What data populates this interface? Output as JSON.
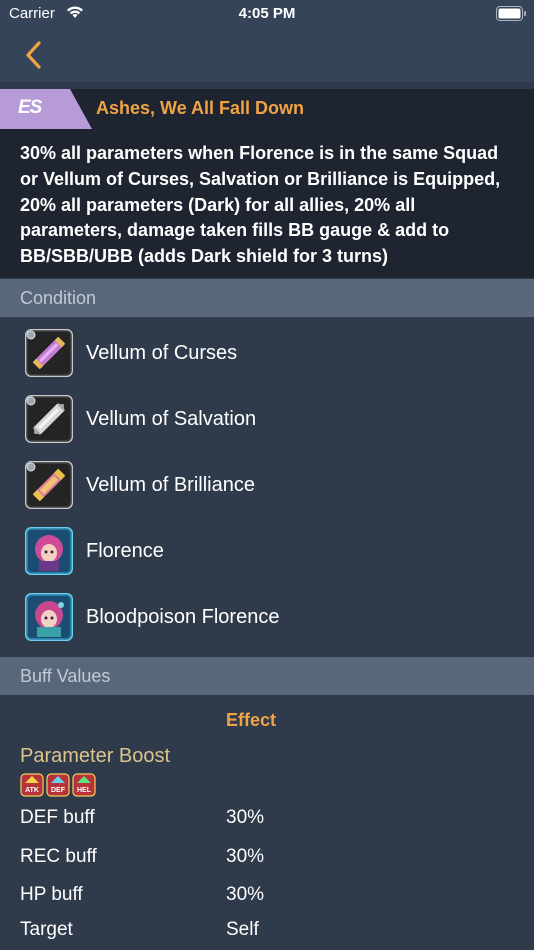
{
  "status_bar": {
    "carrier": "Carrier",
    "time": "4:05 PM"
  },
  "es": {
    "tag": "ES",
    "title": "Ashes, We All Fall Down",
    "description": "30% all parameters when Florence is in the same Squad or Vellum of Curses, Salvation or Brilliance is Equipped, 20% all parameters (Dark) for all allies, 20% all parameters, damage taken fills BB gauge & add to BB/SBB/UBB (adds Dark shield for 3 turns)"
  },
  "condition": {
    "header": "Condition",
    "items": [
      {
        "label": "Vellum of Curses",
        "icon": "vellum-curses-icon"
      },
      {
        "label": "Vellum of Salvation",
        "icon": "vellum-salvation-icon"
      },
      {
        "label": "Vellum of Brilliance",
        "icon": "vellum-brilliance-icon"
      },
      {
        "label": "Florence",
        "icon": "florence-unit-icon"
      },
      {
        "label": "Bloodpoison Florence",
        "icon": "bloodpoison-florence-unit-icon"
      }
    ]
  },
  "buff_values": {
    "header": "Buff Values",
    "column_effect": "Effect",
    "group_title": "Parameter Boost",
    "badges": [
      "ATK",
      "DEF",
      "HEL"
    ],
    "rows": [
      {
        "label": "DEF buff",
        "value": "30%"
      },
      {
        "label": "REC buff",
        "value": "30%"
      },
      {
        "label": "HP buff",
        "value": "30%"
      },
      {
        "label": "Target",
        "value": "Self"
      }
    ]
  },
  "colors": {
    "accent_orange": "#f0a345",
    "tag_purple": "#b79bd9",
    "group_gold": "#dcc58c",
    "section_header_bg": "#59677a"
  }
}
